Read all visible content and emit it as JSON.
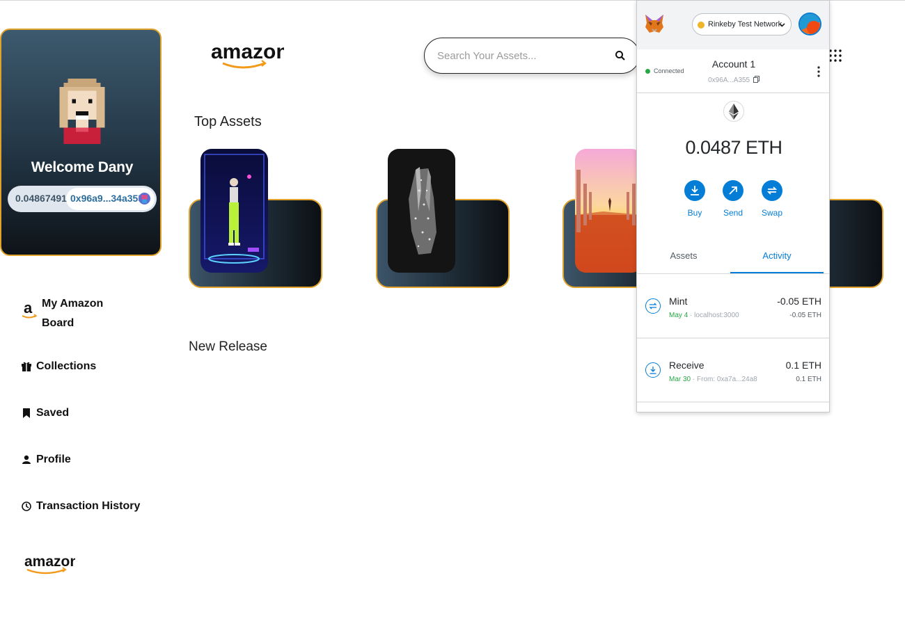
{
  "profile": {
    "welcome": "Welcome Dany",
    "balance": "0.04867491",
    "address": "0x96a9...34a355"
  },
  "sidebar": {
    "items": [
      {
        "label": "My Amazon Board",
        "icon": "amazon-icon"
      },
      {
        "label": "Collections",
        "icon": "gift-icon"
      },
      {
        "label": "Saved",
        "icon": "bookmark-icon"
      },
      {
        "label": "Profile",
        "icon": "user-icon"
      },
      {
        "label": "Transaction History",
        "icon": "history-icon"
      }
    ],
    "logo": "amazon"
  },
  "header": {
    "logo": "amazon",
    "search_placeholder": "Search Your Assets..."
  },
  "sections": {
    "top_assets": "Top Assets",
    "new_release": "New Release"
  },
  "metamask": {
    "network": "Rinkeby Test Network",
    "status": "Connected",
    "account_name": "Account 1",
    "account_address": "0x96A...A355",
    "balance": "0.0487 ETH",
    "actions": [
      "Buy",
      "Send",
      "Swap"
    ],
    "tabs": [
      "Assets",
      "Activity"
    ],
    "active_tab": "Activity",
    "transactions": [
      {
        "title": "Mint",
        "date": "May 4",
        "origin": "localhost:3000",
        "amount": "-0.05 ETH",
        "amount_secondary": "-0.05 ETH",
        "icon": "swap-icon"
      },
      {
        "title": "Receive",
        "date": "Mar 30",
        "origin": "From: 0xa7a...24a8",
        "amount": "0.1 ETH",
        "amount_secondary": "0.1 ETH",
        "icon": "receive-icon"
      }
    ],
    "colors": {
      "primary": "#037dd6",
      "connected": "#28a745",
      "network_dot": "#f0b429"
    }
  },
  "colors": {
    "card_border": "#e0a22b",
    "card_gradient_start": "#3d5a6e",
    "card_gradient_end": "#0e1318"
  }
}
